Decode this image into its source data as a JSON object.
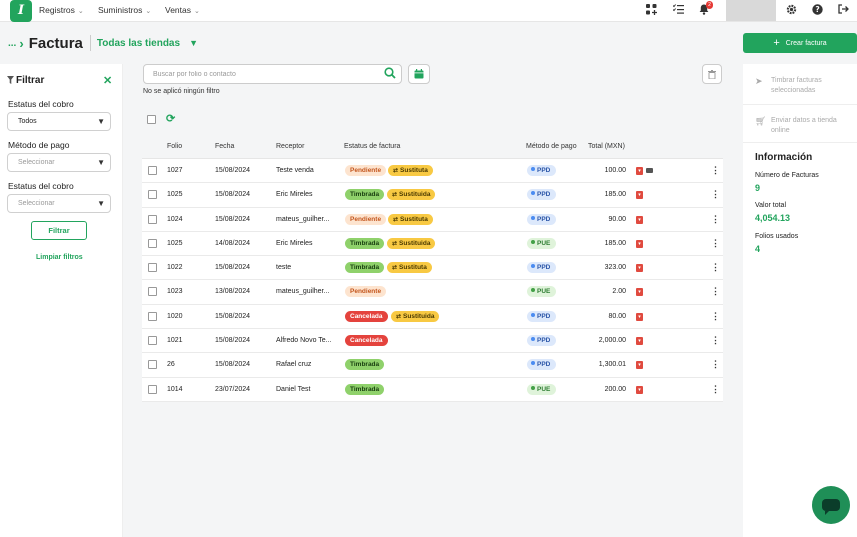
{
  "topbar": {
    "logo_letter": "I",
    "menus": [
      {
        "label": "Registros"
      },
      {
        "label": "Suministros"
      },
      {
        "label": "Ventas"
      }
    ],
    "notification_count": "2"
  },
  "header": {
    "breadcrumb_dots": "...",
    "title": "Factura",
    "store_selector": "Todas las tiendas",
    "create_button": "Crear factura"
  },
  "sidebar": {
    "title": "Filtrar",
    "filters": [
      {
        "label": "Estatus del cobro",
        "value": "Todos",
        "placeholder": false
      },
      {
        "label": "Método de pago",
        "value": "Seleccionar",
        "placeholder": true
      },
      {
        "label": "Estatus del cobro",
        "value": "Seleccionar",
        "placeholder": true
      }
    ],
    "filter_button": "Filtrar",
    "clear_link": "Limpiar filtros"
  },
  "search": {
    "placeholder": "Buscar por folio o contacto",
    "value": ""
  },
  "filter_status": "No se aplicó ningún filtro",
  "table": {
    "headers": {
      "folio": "Folio",
      "fecha": "Fecha",
      "receptor": "Receptor",
      "estatus": "Estatus de factura",
      "metodo": "Método de pago",
      "total": "Total (MXN)"
    },
    "rows": [
      {
        "folio": "1027",
        "fecha": "15/08/2024",
        "receptor": "Teste venda",
        "estatus": [
          {
            "label": "Pendiente",
            "kind": "pend"
          },
          {
            "label": "Sustituta",
            "kind": "sust"
          }
        ],
        "metodo": "PPD",
        "total": "100.00",
        "mail": true
      },
      {
        "folio": "1025",
        "fecha": "15/08/2024",
        "receptor": "Eric Mireles",
        "estatus": [
          {
            "label": "Timbrada",
            "kind": "timb"
          },
          {
            "label": "Sustituida",
            "kind": "sust"
          }
        ],
        "metodo": "PPD",
        "total": "185.00",
        "mail": false
      },
      {
        "folio": "1024",
        "fecha": "15/08/2024",
        "receptor": "mateus_guilher...",
        "estatus": [
          {
            "label": "Pendiente",
            "kind": "pend"
          },
          {
            "label": "Sustituta",
            "kind": "sust"
          }
        ],
        "metodo": "PPD",
        "total": "90.00",
        "mail": false
      },
      {
        "folio": "1025",
        "fecha": "14/08/2024",
        "receptor": "Eric Mireles",
        "estatus": [
          {
            "label": "Timbrada",
            "kind": "timb"
          },
          {
            "label": "Sustituida",
            "kind": "sust"
          }
        ],
        "metodo": "PUE",
        "total": "185.00",
        "mail": false
      },
      {
        "folio": "1022",
        "fecha": "15/08/2024",
        "receptor": "teste",
        "estatus": [
          {
            "label": "Timbrada",
            "kind": "timb"
          },
          {
            "label": "Sustituta",
            "kind": "sust"
          }
        ],
        "metodo": "PPD",
        "total": "323.00",
        "mail": false
      },
      {
        "folio": "1023",
        "fecha": "13/08/2024",
        "receptor": "mateus_guilher...",
        "estatus": [
          {
            "label": "Pendiente",
            "kind": "pend"
          }
        ],
        "metodo": "PUE",
        "total": "2.00",
        "mail": false
      },
      {
        "folio": "1020",
        "fecha": "15/08/2024",
        "receptor": "",
        "estatus": [
          {
            "label": "Cancelada",
            "kind": "canc"
          },
          {
            "label": "Sustituida",
            "kind": "sust"
          }
        ],
        "metodo": "PPD",
        "total": "80.00",
        "mail": false
      },
      {
        "folio": "1021",
        "fecha": "15/08/2024",
        "receptor": "Alfredo Novo Te...",
        "estatus": [
          {
            "label": "Cancelada",
            "kind": "canc"
          }
        ],
        "metodo": "PPD",
        "total": "2,000.00",
        "mail": false
      },
      {
        "folio": "26",
        "fecha": "15/08/2024",
        "receptor": "Rafael cruz",
        "estatus": [
          {
            "label": "Timbrada",
            "kind": "timb"
          }
        ],
        "metodo": "PPD",
        "total": "1,300.01",
        "mail": false
      },
      {
        "folio": "1014",
        "fecha": "23/07/2024",
        "receptor": "Daniel Test",
        "estatus": [
          {
            "label": "Timbrada",
            "kind": "timb"
          }
        ],
        "metodo": "PUE",
        "total": "200.00",
        "mail": false
      }
    ]
  },
  "right_panel": {
    "actions": [
      {
        "label_line1": "Timbrar facturas",
        "label_line2": "seleccionadas"
      },
      {
        "label_line1": "Enviar datos a tienda",
        "label_line2": "online"
      }
    ],
    "info_title": "Información",
    "stats": [
      {
        "label": "Número de Facturas",
        "value": "9"
      },
      {
        "label": "Valor total",
        "value": "4,054.13"
      },
      {
        "label": "Folios usados",
        "value": "4"
      }
    ]
  },
  "colors": {
    "accent": "#22a45d",
    "pending": "#fde4cf",
    "stamped": "#8fd16b",
    "cancelled": "#e4433d",
    "substitute": "#f8c943",
    "ppd": "#dce8fb",
    "pue": "#dff3da"
  }
}
